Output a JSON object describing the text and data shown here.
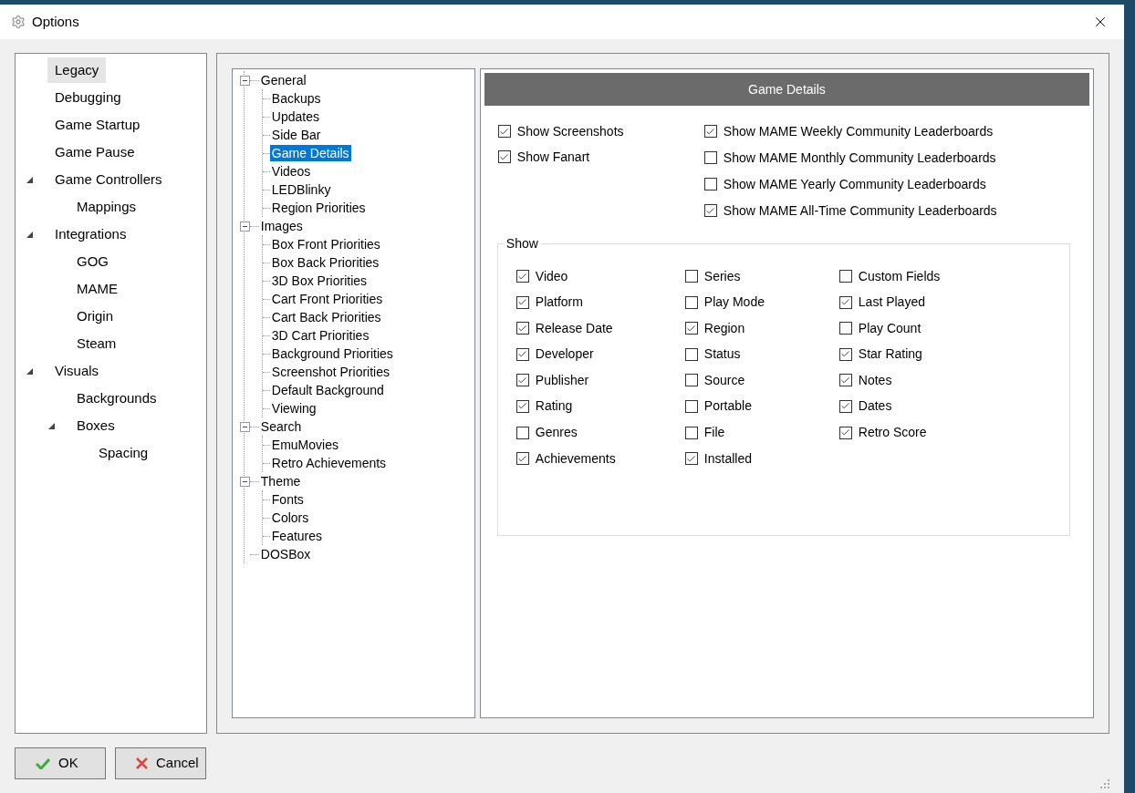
{
  "window": {
    "title": "Options"
  },
  "nav": [
    {
      "label": "Legacy",
      "selected": true
    },
    {
      "label": "Debugging",
      "selected": false
    },
    {
      "label": "Game Startup",
      "selected": false
    },
    {
      "label": "Game Pause",
      "selected": false
    },
    {
      "label": "Game Controllers",
      "selected": false,
      "expanded": true,
      "children": [
        {
          "label": "Mappings",
          "selected": false
        }
      ]
    },
    {
      "label": "Integrations",
      "selected": false,
      "expanded": true,
      "children": [
        {
          "label": "GOG",
          "selected": false
        },
        {
          "label": "MAME",
          "selected": false
        },
        {
          "label": "Origin",
          "selected": false
        },
        {
          "label": "Steam",
          "selected": false
        }
      ]
    },
    {
      "label": "Visuals",
      "selected": false,
      "expanded": true,
      "children": [
        {
          "label": "Backgrounds",
          "selected": false
        },
        {
          "label": "Boxes",
          "selected": false,
          "expanded": true,
          "children": [
            {
              "label": "Spacing",
              "selected": false
            }
          ]
        }
      ]
    }
  ],
  "tree": [
    {
      "label": "General",
      "selected": false,
      "expanded": true,
      "children": [
        {
          "label": "Backups",
          "selected": false
        },
        {
          "label": "Updates",
          "selected": false
        },
        {
          "label": "Side Bar",
          "selected": false
        },
        {
          "label": "Game Details",
          "selected": true
        },
        {
          "label": "Videos",
          "selected": false
        },
        {
          "label": "LEDBlinky",
          "selected": false
        },
        {
          "label": "Region Priorities",
          "selected": false
        }
      ]
    },
    {
      "label": "Images",
      "selected": false,
      "expanded": true,
      "children": [
        {
          "label": "Box Front Priorities",
          "selected": false
        },
        {
          "label": "Box Back Priorities",
          "selected": false
        },
        {
          "label": "3D Box Priorities",
          "selected": false
        },
        {
          "label": "Cart Front Priorities",
          "selected": false
        },
        {
          "label": "Cart Back Priorities",
          "selected": false
        },
        {
          "label": "3D Cart Priorities",
          "selected": false
        },
        {
          "label": "Background Priorities",
          "selected": false
        },
        {
          "label": "Screenshot Priorities",
          "selected": false
        },
        {
          "label": "Default Background",
          "selected": false
        },
        {
          "label": "Viewing",
          "selected": false
        }
      ]
    },
    {
      "label": "Search",
      "selected": false,
      "expanded": true,
      "children": [
        {
          "label": "EmuMovies",
          "selected": false
        },
        {
          "label": "Retro Achievements",
          "selected": false
        }
      ]
    },
    {
      "label": "Theme",
      "selected": false,
      "expanded": true,
      "children": [
        {
          "label": "Fonts",
          "selected": false
        },
        {
          "label": "Colors",
          "selected": false
        },
        {
          "label": "Features",
          "selected": false
        }
      ]
    },
    {
      "label": "DOSBox",
      "selected": false
    }
  ],
  "panel": {
    "header": "Game Details",
    "top_columns": [
      [
        {
          "label": "Show Screenshots",
          "checked": true
        },
        {
          "label": "Show Fanart",
          "checked": true
        }
      ],
      [
        {
          "label": "Show MAME Weekly Community Leaderboards",
          "checked": true
        },
        {
          "label": "Show MAME Monthly Community Leaderboards",
          "checked": false
        },
        {
          "label": "Show MAME Yearly Community Leaderboards",
          "checked": false
        },
        {
          "label": "Show MAME All-Time Community Leaderboards",
          "checked": true
        }
      ]
    ],
    "show_group": {
      "legend": "Show",
      "columns": [
        [
          {
            "label": "Video",
            "checked": true
          },
          {
            "label": "Platform",
            "checked": true
          },
          {
            "label": "Release Date",
            "checked": true
          },
          {
            "label": "Developer",
            "checked": true
          },
          {
            "label": "Publisher",
            "checked": true
          },
          {
            "label": "Rating",
            "checked": true
          },
          {
            "label": "Genres",
            "checked": false
          },
          {
            "label": "Achievements",
            "checked": true
          }
        ],
        [
          {
            "label": "Series",
            "checked": false
          },
          {
            "label": "Play Mode",
            "checked": false
          },
          {
            "label": "Region",
            "checked": true
          },
          {
            "label": "Status",
            "checked": false
          },
          {
            "label": "Source",
            "checked": false
          },
          {
            "label": "Portable",
            "checked": false
          },
          {
            "label": "File",
            "checked": false
          },
          {
            "label": "Installed",
            "checked": true
          }
        ],
        [
          {
            "label": "Custom Fields",
            "checked": false
          },
          {
            "label": "Last Played",
            "checked": true
          },
          {
            "label": "Play Count",
            "checked": false
          },
          {
            "label": "Star Rating",
            "checked": true
          },
          {
            "label": "Notes",
            "checked": true
          },
          {
            "label": "Dates",
            "checked": true
          },
          {
            "label": "Retro Score",
            "checked": true
          }
        ]
      ]
    }
  },
  "buttons": [
    {
      "kind": "ok",
      "label": "OK"
    },
    {
      "kind": "cancel",
      "label": "Cancel"
    }
  ]
}
